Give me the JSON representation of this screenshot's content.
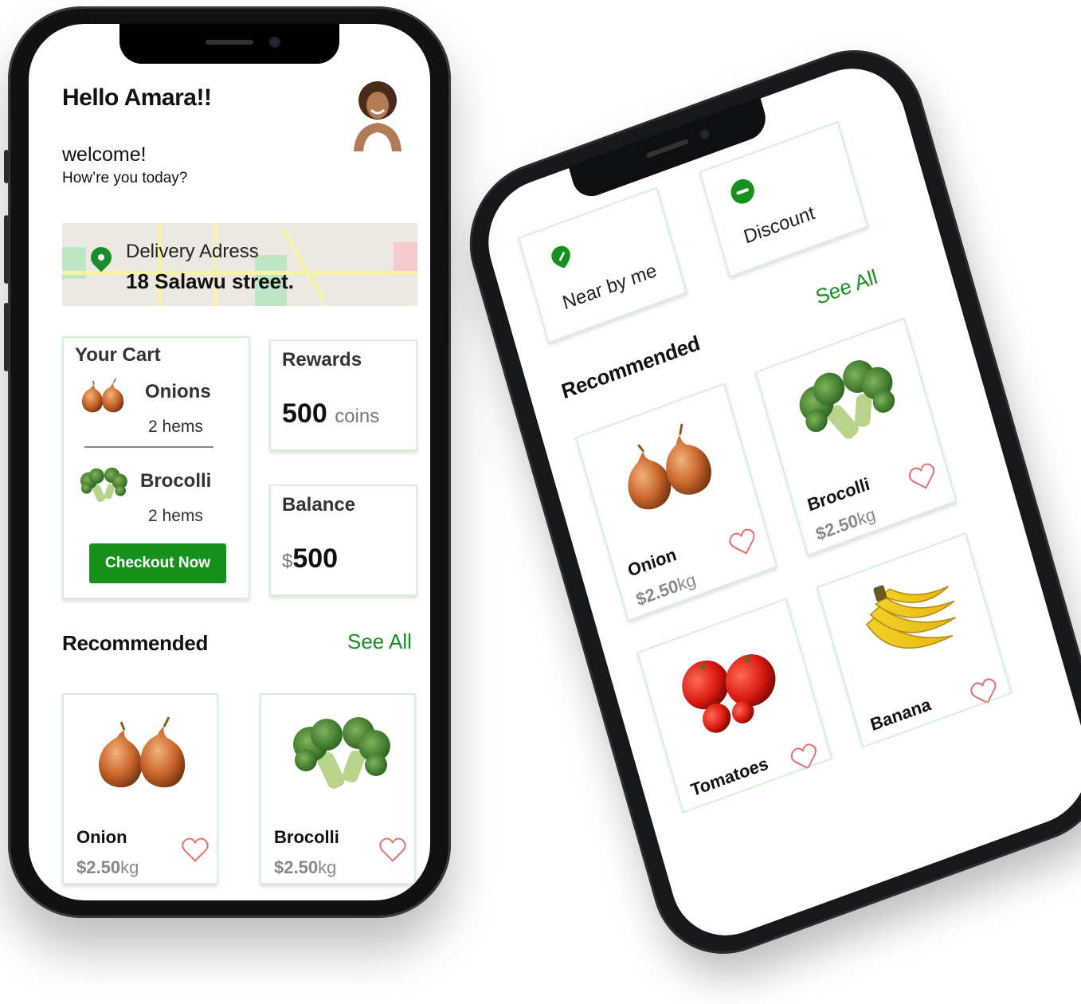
{
  "phone_home": {
    "greeting": "Hello Amara!!",
    "welcome": "welcome!",
    "subtitle": "How’re you today?",
    "delivery": {
      "label": "Delivery Adress",
      "address": "18 Salawu street."
    },
    "cart": {
      "title": "Your Cart",
      "items": [
        {
          "name": "Onions",
          "qty": "2 hems",
          "icon": "onion-image"
        },
        {
          "name": "Brocolli",
          "qty": "2 hems",
          "icon": "broccoli-image"
        }
      ],
      "checkout_label": "Checkout Now"
    },
    "rewards": {
      "title": "Rewards",
      "value": "500",
      "unit": "coins"
    },
    "balance": {
      "title": "Balance",
      "currency": "$",
      "value": "500"
    },
    "recommended": {
      "title": "Recommended",
      "see_all": "See All",
      "products": [
        {
          "name": "Onion",
          "currency": "$",
          "price": "2.50",
          "unit": "kg",
          "icon": "onion-image"
        },
        {
          "name": "Brocolli",
          "currency": "$",
          "price": "2.50",
          "unit": "kg",
          "icon": "broccoli-image"
        }
      ]
    }
  },
  "phone_browse": {
    "filters": [
      {
        "label": "Near by me",
        "icon": "location-pin-icon"
      },
      {
        "label": "Discount",
        "icon": "minus-circle-icon"
      }
    ],
    "recommended": {
      "title": "Recommended",
      "see_all": "See All",
      "products": [
        {
          "name": "Onion",
          "currency": "$",
          "price": "2.50",
          "unit": "kg",
          "icon": "onion-image"
        },
        {
          "name": "Brocolli",
          "currency": "$",
          "price": "2.50",
          "unit": "kg",
          "icon": "broccoli-image"
        },
        {
          "name": "Tomatoes",
          "icon": "tomato-image"
        },
        {
          "name": "Banana",
          "icon": "banana-image"
        }
      ]
    }
  },
  "colors": {
    "brand_green": "#17901e",
    "card_border": "#d8eed8",
    "heart": "#e46a6a",
    "price_grey": "#888888"
  }
}
